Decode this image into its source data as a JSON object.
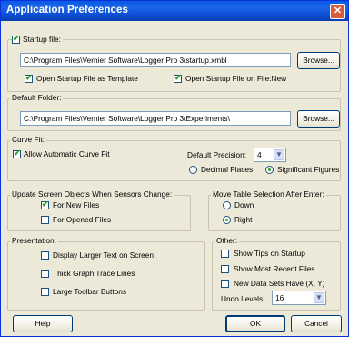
{
  "window": {
    "title": "Application Preferences"
  },
  "startup": {
    "group_label": "Startup file:",
    "startup_checked": true,
    "path": "C:\\Program Files\\Vernier Software\\Logger Pro 3\\startup.xmbl",
    "browse_label": "Browse...",
    "template_label": "Open Startup File as Template",
    "template_checked": true,
    "on_new_label": "Open Startup File on File:New",
    "on_new_checked": true
  },
  "folder": {
    "group_label": "Default Folder:",
    "path": "C:\\Program Files\\Vernier Software\\Logger Pro 3\\Experiments\\",
    "browse_label": "Browse..."
  },
  "curve_fit": {
    "group_label": "Curve Fit:",
    "auto_label": "Allow Automatic Curve Fit",
    "auto_checked": true,
    "precision_label": "Default Precision:",
    "precision_value": "4",
    "decimal_label": "Decimal Places",
    "sig_label": "Significant Figures",
    "selected": "sig"
  },
  "update_objects": {
    "group_label": "Update Screen Objects When Sensors Change:",
    "new_files_label": "For New Files",
    "new_files_checked": true,
    "opened_files_label": "For Opened Files",
    "opened_files_checked": false
  },
  "move_table": {
    "group_label": "Move Table Selection After Enter:",
    "down_label": "Down",
    "right_label": "Right",
    "selected": "right"
  },
  "presentation": {
    "group_label": "Presentation:",
    "larger_text_label": "Display Larger Text on Screen",
    "thick_lines_label": "Thick Graph Trace Lines",
    "large_buttons_label": "Large Toolbar Buttons"
  },
  "other": {
    "group_label": "Other:",
    "tips_label": "Show Tips on Startup",
    "recent_label": "Show Most Recent Files",
    "new_data_label": "New Data Sets Have (X, Y)",
    "undo_label": "Undo Levels:",
    "undo_value": "16"
  },
  "buttons": {
    "help": "Help",
    "ok": "OK",
    "cancel": "Cancel"
  }
}
